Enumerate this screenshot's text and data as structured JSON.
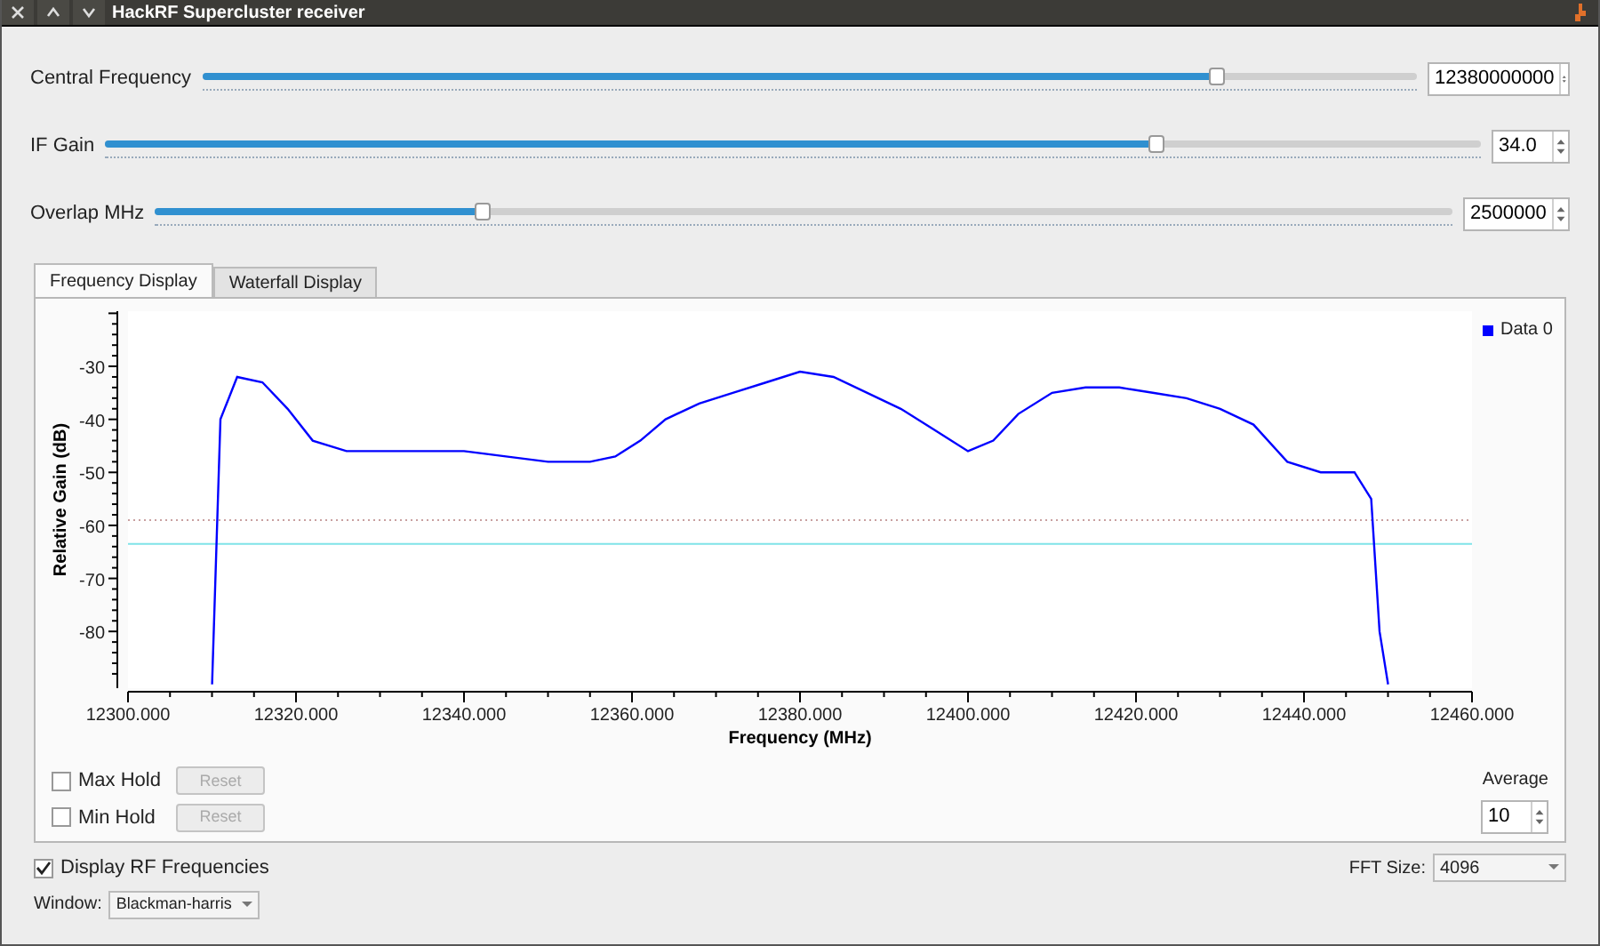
{
  "window": {
    "title": "HackRF Supercluster receiver"
  },
  "sliders": [
    {
      "label": "Central Frequency",
      "level": 0.835,
      "value": "12380000000"
    },
    {
      "label": "IF Gain",
      "level": 0.764,
      "value": "34.0"
    },
    {
      "label": "Overlap MHz",
      "level": 0.252,
      "value": "2500000"
    }
  ],
  "tabs": [
    {
      "label": "Frequency Display",
      "selected": true
    },
    {
      "label": "Waterfall Display",
      "selected": false
    }
  ],
  "chart": {
    "chart_data": {
      "type": "line",
      "xlabel": "Frequency (MHz)",
      "ylabel": "Relative Gain (dB)",
      "xlim": [
        12300,
        12460
      ],
      "ylim": [
        -90.7,
        -19.6
      ],
      "xticks": [
        {
          "value": 12300,
          "label": "12300.000"
        },
        {
          "value": 12320,
          "label": "12320.000"
        },
        {
          "value": 12340,
          "label": "12340.000"
        },
        {
          "value": 12360,
          "label": "12360.000"
        },
        {
          "value": 12380,
          "label": "12380.000"
        },
        {
          "value": 12400,
          "label": "12400.000"
        },
        {
          "value": 12420,
          "label": "12420.000"
        },
        {
          "value": 12440,
          "label": "12440.000"
        },
        {
          "value": 12460,
          "label": "12460.000"
        }
      ],
      "yticks": [
        -30,
        -40,
        -50,
        -60,
        -70,
        -80
      ],
      "ref_lines": [
        {
          "axis": "y",
          "value": -59
        },
        {
          "axis": "y",
          "value": -63.5
        }
      ],
      "x": [
        12310,
        12311,
        12313,
        12316,
        12319,
        12322,
        12326,
        12330,
        12335,
        12340,
        12345,
        12350,
        12355,
        12358,
        12361,
        12364,
        12368,
        12372,
        12376,
        12380,
        12384,
        12388,
        12392,
        12396,
        12400,
        12403,
        12406,
        12410,
        12414,
        12418,
        12422,
        12426,
        12430,
        12434,
        12438,
        12442,
        12446,
        12448,
        12449,
        12450
      ],
      "series": [
        {
          "name": "Data 0",
          "color": "#0000ff",
          "values": [
            -90,
            -40,
            -32,
            -33,
            -38,
            -44,
            -46,
            -46,
            -46,
            -46,
            -47,
            -48,
            -48,
            -47,
            -44,
            -40,
            -37,
            -35,
            -33,
            -31,
            -32,
            -35,
            -38,
            -42,
            -46,
            -44,
            -39,
            -35,
            -34,
            -34,
            -35,
            -36,
            -38,
            -41,
            -48,
            -50,
            -50,
            -55,
            -80,
            -90
          ]
        }
      ]
    }
  },
  "holds": [
    {
      "label": "Max Hold",
      "checked": false,
      "button": "Reset"
    },
    {
      "label": "Min Hold",
      "checked": false,
      "button": "Reset"
    }
  ],
  "average": {
    "label": "Average",
    "value": "10"
  },
  "display_rf": {
    "label": "Display RF Frequencies",
    "checked": true
  },
  "fft_size": {
    "label": "FFT Size:",
    "value": "4096"
  },
  "window_fn": {
    "label": "Window:",
    "value": "Blackman-harris"
  }
}
